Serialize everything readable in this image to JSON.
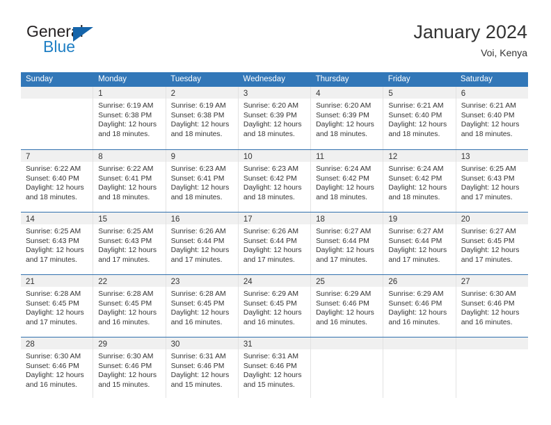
{
  "brand": {
    "name_part1": "General",
    "name_part2": "Blue",
    "logo_icon": "blue-triangle-logo"
  },
  "header": {
    "title": "January 2024",
    "subtitle": "Voi, Kenya"
  },
  "colors": {
    "header_blue": "#3277b8",
    "row_divider_blue": "#2f6fae",
    "daynum_band": "#f0f0f0",
    "brand_blue": "#1f7fc4",
    "text": "#333333"
  },
  "weekdays": [
    "Sunday",
    "Monday",
    "Tuesday",
    "Wednesday",
    "Thursday",
    "Friday",
    "Saturday"
  ],
  "weeks": [
    [
      {
        "day": "",
        "sunrise": "",
        "sunset": "",
        "daylight1": "",
        "daylight2": ""
      },
      {
        "day": "1",
        "sunrise": "Sunrise: 6:19 AM",
        "sunset": "Sunset: 6:38 PM",
        "daylight1": "Daylight: 12 hours",
        "daylight2": "and 18 minutes."
      },
      {
        "day": "2",
        "sunrise": "Sunrise: 6:19 AM",
        "sunset": "Sunset: 6:38 PM",
        "daylight1": "Daylight: 12 hours",
        "daylight2": "and 18 minutes."
      },
      {
        "day": "3",
        "sunrise": "Sunrise: 6:20 AM",
        "sunset": "Sunset: 6:39 PM",
        "daylight1": "Daylight: 12 hours",
        "daylight2": "and 18 minutes."
      },
      {
        "day": "4",
        "sunrise": "Sunrise: 6:20 AM",
        "sunset": "Sunset: 6:39 PM",
        "daylight1": "Daylight: 12 hours",
        "daylight2": "and 18 minutes."
      },
      {
        "day": "5",
        "sunrise": "Sunrise: 6:21 AM",
        "sunset": "Sunset: 6:40 PM",
        "daylight1": "Daylight: 12 hours",
        "daylight2": "and 18 minutes."
      },
      {
        "day": "6",
        "sunrise": "Sunrise: 6:21 AM",
        "sunset": "Sunset: 6:40 PM",
        "daylight1": "Daylight: 12 hours",
        "daylight2": "and 18 minutes."
      }
    ],
    [
      {
        "day": "7",
        "sunrise": "Sunrise: 6:22 AM",
        "sunset": "Sunset: 6:40 PM",
        "daylight1": "Daylight: 12 hours",
        "daylight2": "and 18 minutes."
      },
      {
        "day": "8",
        "sunrise": "Sunrise: 6:22 AM",
        "sunset": "Sunset: 6:41 PM",
        "daylight1": "Daylight: 12 hours",
        "daylight2": "and 18 minutes."
      },
      {
        "day": "9",
        "sunrise": "Sunrise: 6:23 AM",
        "sunset": "Sunset: 6:41 PM",
        "daylight1": "Daylight: 12 hours",
        "daylight2": "and 18 minutes."
      },
      {
        "day": "10",
        "sunrise": "Sunrise: 6:23 AM",
        "sunset": "Sunset: 6:42 PM",
        "daylight1": "Daylight: 12 hours",
        "daylight2": "and 18 minutes."
      },
      {
        "day": "11",
        "sunrise": "Sunrise: 6:24 AM",
        "sunset": "Sunset: 6:42 PM",
        "daylight1": "Daylight: 12 hours",
        "daylight2": "and 18 minutes."
      },
      {
        "day": "12",
        "sunrise": "Sunrise: 6:24 AM",
        "sunset": "Sunset: 6:42 PM",
        "daylight1": "Daylight: 12 hours",
        "daylight2": "and 18 minutes."
      },
      {
        "day": "13",
        "sunrise": "Sunrise: 6:25 AM",
        "sunset": "Sunset: 6:43 PM",
        "daylight1": "Daylight: 12 hours",
        "daylight2": "and 17 minutes."
      }
    ],
    [
      {
        "day": "14",
        "sunrise": "Sunrise: 6:25 AM",
        "sunset": "Sunset: 6:43 PM",
        "daylight1": "Daylight: 12 hours",
        "daylight2": "and 17 minutes."
      },
      {
        "day": "15",
        "sunrise": "Sunrise: 6:25 AM",
        "sunset": "Sunset: 6:43 PM",
        "daylight1": "Daylight: 12 hours",
        "daylight2": "and 17 minutes."
      },
      {
        "day": "16",
        "sunrise": "Sunrise: 6:26 AM",
        "sunset": "Sunset: 6:44 PM",
        "daylight1": "Daylight: 12 hours",
        "daylight2": "and 17 minutes."
      },
      {
        "day": "17",
        "sunrise": "Sunrise: 6:26 AM",
        "sunset": "Sunset: 6:44 PM",
        "daylight1": "Daylight: 12 hours",
        "daylight2": "and 17 minutes."
      },
      {
        "day": "18",
        "sunrise": "Sunrise: 6:27 AM",
        "sunset": "Sunset: 6:44 PM",
        "daylight1": "Daylight: 12 hours",
        "daylight2": "and 17 minutes."
      },
      {
        "day": "19",
        "sunrise": "Sunrise: 6:27 AM",
        "sunset": "Sunset: 6:44 PM",
        "daylight1": "Daylight: 12 hours",
        "daylight2": "and 17 minutes."
      },
      {
        "day": "20",
        "sunrise": "Sunrise: 6:27 AM",
        "sunset": "Sunset: 6:45 PM",
        "daylight1": "Daylight: 12 hours",
        "daylight2": "and 17 minutes."
      }
    ],
    [
      {
        "day": "21",
        "sunrise": "Sunrise: 6:28 AM",
        "sunset": "Sunset: 6:45 PM",
        "daylight1": "Daylight: 12 hours",
        "daylight2": "and 17 minutes."
      },
      {
        "day": "22",
        "sunrise": "Sunrise: 6:28 AM",
        "sunset": "Sunset: 6:45 PM",
        "daylight1": "Daylight: 12 hours",
        "daylight2": "and 16 minutes."
      },
      {
        "day": "23",
        "sunrise": "Sunrise: 6:28 AM",
        "sunset": "Sunset: 6:45 PM",
        "daylight1": "Daylight: 12 hours",
        "daylight2": "and 16 minutes."
      },
      {
        "day": "24",
        "sunrise": "Sunrise: 6:29 AM",
        "sunset": "Sunset: 6:45 PM",
        "daylight1": "Daylight: 12 hours",
        "daylight2": "and 16 minutes."
      },
      {
        "day": "25",
        "sunrise": "Sunrise: 6:29 AM",
        "sunset": "Sunset: 6:46 PM",
        "daylight1": "Daylight: 12 hours",
        "daylight2": "and 16 minutes."
      },
      {
        "day": "26",
        "sunrise": "Sunrise: 6:29 AM",
        "sunset": "Sunset: 6:46 PM",
        "daylight1": "Daylight: 12 hours",
        "daylight2": "and 16 minutes."
      },
      {
        "day": "27",
        "sunrise": "Sunrise: 6:30 AM",
        "sunset": "Sunset: 6:46 PM",
        "daylight1": "Daylight: 12 hours",
        "daylight2": "and 16 minutes."
      }
    ],
    [
      {
        "day": "28",
        "sunrise": "Sunrise: 6:30 AM",
        "sunset": "Sunset: 6:46 PM",
        "daylight1": "Daylight: 12 hours",
        "daylight2": "and 16 minutes."
      },
      {
        "day": "29",
        "sunrise": "Sunrise: 6:30 AM",
        "sunset": "Sunset: 6:46 PM",
        "daylight1": "Daylight: 12 hours",
        "daylight2": "and 15 minutes."
      },
      {
        "day": "30",
        "sunrise": "Sunrise: 6:31 AM",
        "sunset": "Sunset: 6:46 PM",
        "daylight1": "Daylight: 12 hours",
        "daylight2": "and 15 minutes."
      },
      {
        "day": "31",
        "sunrise": "Sunrise: 6:31 AM",
        "sunset": "Sunset: 6:46 PM",
        "daylight1": "Daylight: 12 hours",
        "daylight2": "and 15 minutes."
      },
      {
        "day": "",
        "sunrise": "",
        "sunset": "",
        "daylight1": "",
        "daylight2": ""
      },
      {
        "day": "",
        "sunrise": "",
        "sunset": "",
        "daylight1": "",
        "daylight2": ""
      },
      {
        "day": "",
        "sunrise": "",
        "sunset": "",
        "daylight1": "",
        "daylight2": ""
      }
    ]
  ]
}
